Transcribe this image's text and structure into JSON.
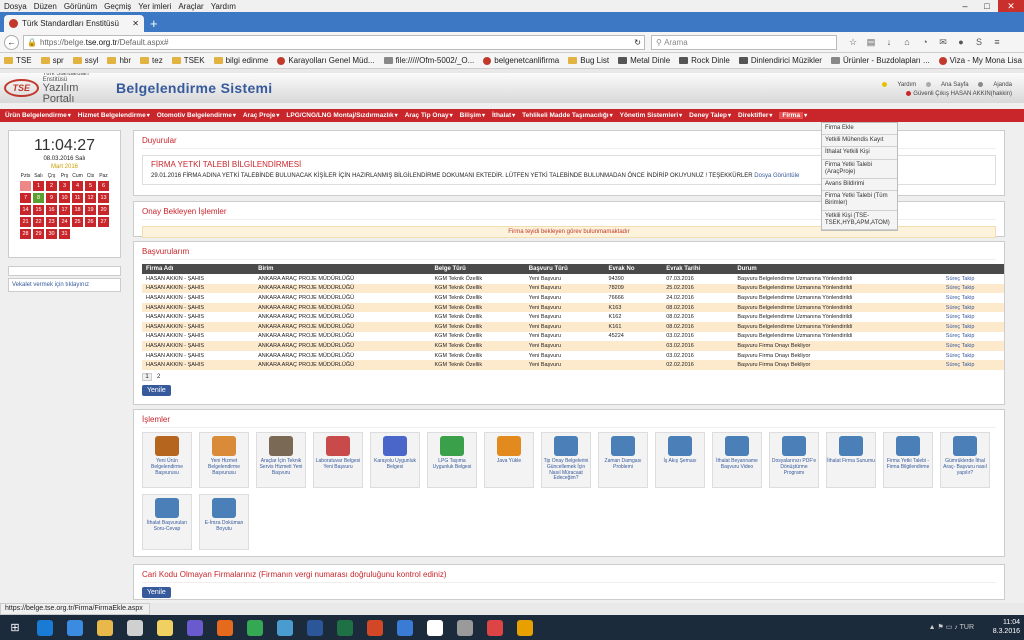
{
  "menubar": {
    "items": [
      "Dosya",
      "Düzen",
      "Görünüm",
      "Geçmiş",
      "Yer imleri",
      "Araçlar",
      "Yardım"
    ]
  },
  "tab": {
    "title": "Türk Standardları Enstitüsü"
  },
  "navbar": {
    "url_prefix": "https://belge.",
    "url_domain": "tse.org.tr",
    "url_suffix": "/Default.aspx#",
    "search_placeholder": "Arama"
  },
  "bookmarks": [
    {
      "label": "TSE",
      "icon": "folder"
    },
    {
      "label": "spr",
      "icon": "folder"
    },
    {
      "label": "ssyl",
      "icon": "folder"
    },
    {
      "label": "hbr",
      "icon": "folder"
    },
    {
      "label": "tez",
      "icon": "folder"
    },
    {
      "label": "TSEK",
      "icon": "folder"
    },
    {
      "label": "bilgi edinme",
      "icon": "folder"
    },
    {
      "label": "Karayolları Genel Müd...",
      "icon": "red"
    },
    {
      "label": "file://///Ofm-5002/_O...",
      "icon": "grey"
    },
    {
      "label": "belgenetcanlifirma",
      "icon": "red"
    },
    {
      "label": "Bug List",
      "icon": "folder"
    },
    {
      "label": "Metal Dinle",
      "icon": "guitar"
    },
    {
      "label": "Rock Dinle",
      "icon": "guitar"
    },
    {
      "label": "Dinlendirici Müzikler",
      "icon": "guitar"
    },
    {
      "label": "Ürünler - Buzdolapları ...",
      "icon": "grey"
    },
    {
      "label": "Viza - My Mona Lisa -...",
      "icon": "red"
    },
    {
      "label": "Ürünler - Buzdolapları ...",
      "icon": "grey"
    }
  ],
  "header": {
    "logo_small": "Türk Standardları Enstitüsü",
    "logo_big": "Yazılım Portalı",
    "logo_mark": "TSE",
    "system_title": "Belgelendirme Sistemi",
    "links": [
      "Yardım",
      "Ana Sayfa",
      "Ajanda"
    ],
    "user": "Güvenli Çıkış HASAN AKKIN(hakkin)"
  },
  "mainnav": [
    "Ürün Belgelendirme",
    "Hizmet Belgelendirme",
    "Otomotiv Belgelendirme",
    "Araç Proje",
    "LPG/CNG/LNG Montaj/Sızdırmazlık",
    "Araç Tip Onay",
    "Bilişim",
    "İthalat",
    "Tehlikeli Madde Taşımacılığı",
    "Yönetim Sistemleri",
    "Deney Talep",
    "Direktifler",
    "Firma"
  ],
  "dropdown": [
    "Firma Ekle",
    "Yetkili Mühendis Kayıt",
    "İthalat Yetkili Kişi",
    "Firma Yetki Talebi (AraçProje)",
    "Avans Bildirimi",
    "Firma Yetki Talebi (Tüm Birimler)",
    "Yetkili Kişi (TSE-TSEK,HYB,APM,ATOM)"
  ],
  "clock": {
    "time": "11:04:27",
    "date": "08.03.2016 Salı",
    "month": "Mart 2016",
    "weekdays": [
      "Pzts",
      "Salı",
      "Çrş",
      "Prş",
      "Cum",
      "Cts",
      "Paz"
    ],
    "weeks": [
      [
        "",
        "1",
        "2",
        "3",
        "4",
        "5",
        "6"
      ],
      [
        "7",
        "8",
        "9",
        "10",
        "11",
        "12",
        "13"
      ],
      [
        "14",
        "15",
        "16",
        "17",
        "18",
        "19",
        "20"
      ],
      [
        "21",
        "22",
        "23",
        "24",
        "25",
        "26",
        "27"
      ],
      [
        "28",
        "29",
        "30",
        "31",
        "",
        "",
        ""
      ]
    ]
  },
  "left": {
    "vekalet": "Vekalet vermek için tıklayınız"
  },
  "duyurular": {
    "title": "Duyurular",
    "ann_title": "FİRMA YETKİ TALEBİ BİLGİLENDİRMESİ",
    "ann_text": "29.01.2016 FİRMA ADINA YETKİ TALEBİNDE BULUNACAK KİŞİLER İÇİN HAZIRLANMIŞ BİLGİLENDİRME DOKUMANI EKTEDİR. LÜTFEN YETKİ TALEBİNDE BULUNMADAN ÖNCE İNDİRİP OKUYUNUZ ! TEŞEKKÜRLER",
    "ann_link": "Dosya Görüntüle"
  },
  "onay": {
    "title": "Onay Bekleyen İşlemler",
    "message": "Firma teyidi bekleyen görev bulunmamaktadır"
  },
  "basvurular": {
    "title": "Başvurularım",
    "columns": [
      "Firma Adı",
      "Birim",
      "Belge Türü",
      "Başvuru Türü",
      "Evrak No",
      "Evrak Tarihi",
      "Durum",
      ""
    ],
    "rows": [
      [
        "HASAN AKKIN - ŞAHIS",
        "ANKARA ARAÇ PROJE MÜDÜRLÜĞÜ",
        "KGM Teknik Özellik",
        "Yeni Başvuru",
        "94390",
        "07.03.2016",
        "Başvuru Belgelendirme Uzmanına Yönlendirildi",
        "Süreç Takip"
      ],
      [
        "HASAN AKKIN - ŞAHIS",
        "ANKARA ARAÇ PROJE MÜDÜRLÜĞÜ",
        "KGM Teknik Özellik",
        "Yeni Başvuru",
        "78209",
        "25.02.2016",
        "Başvuru Belgelendirme Uzmanına Yönlendirildi",
        "Süreç Takip"
      ],
      [
        "HASAN AKKIN - ŞAHIS",
        "ANKARA ARAÇ PROJE MÜDÜRLÜĞÜ",
        "KGM Teknik Özellik",
        "Yeni Başvuru",
        "76666",
        "24.02.2016",
        "Başvuru Belgelendirme Uzmanına Yönlendirildi",
        "Süreç Takip"
      ],
      [
        "HASAN AKKIN - ŞAHIS",
        "ANKARA ARAÇ PROJE MÜDÜRLÜĞÜ",
        "KGM Teknik Özellik",
        "Yeni Başvuru",
        "K163",
        "08.02.2016",
        "Başvuru Belgelendirme Uzmanına Yönlendirildi",
        "Süreç Takip"
      ],
      [
        "HASAN AKKIN - ŞAHIS",
        "ANKARA ARAÇ PROJE MÜDÜRLÜĞÜ",
        "KGM Teknik Özellik",
        "Yeni Başvuru",
        "K162",
        "08.02.2016",
        "Başvuru Belgelendirme Uzmanına Yönlendirildi",
        "Süreç Takip"
      ],
      [
        "HASAN AKKIN - ŞAHIS",
        "ANKARA ARAÇ PROJE MÜDÜRLÜĞÜ",
        "KGM Teknik Özellik",
        "Yeni Başvuru",
        "K161",
        "08.02.2016",
        "Başvuru Belgelendirme Uzmanına Yönlendirildi",
        "Süreç Takip"
      ],
      [
        "HASAN AKKIN - ŞAHIS",
        "ANKARA ARAÇ PROJE MÜDÜRLÜĞÜ",
        "KGM Teknik Özellik",
        "Yeni Başvuru",
        "45224",
        "03.02.2016",
        "Başvuru Belgelendirme Uzmanına Yönlendirildi",
        "Süreç Takip"
      ],
      [
        "HASAN AKKIN - ŞAHIS",
        "ANKARA ARAÇ PROJE MÜDÜRLÜĞÜ",
        "KGM Teknik Özellik",
        "Yeni Başvuru",
        "",
        "03.02.2016",
        "Başvuru Firma Onayı Bekliyor",
        "Süreç Takip"
      ],
      [
        "HASAN AKKIN - ŞAHIS",
        "ANKARA ARAÇ PROJE MÜDÜRLÜĞÜ",
        "KGM Teknik Özellik",
        "Yeni Başvuru",
        "",
        "03.02.2016",
        "Başvuru Firma Onayı Bekliyor",
        "Süreç Takip"
      ],
      [
        "HASAN AKKIN - ŞAHIS",
        "ANKARA ARAÇ PROJE MÜDÜRLÜĞÜ",
        "KGM Teknik Özellik",
        "Yeni Başvuru",
        "",
        "02.02.2016",
        "Başvuru Firma Onayı Bekliyor",
        "Süreç Takip"
      ]
    ],
    "pages": [
      "1",
      "2"
    ],
    "refresh": "Yenile"
  },
  "islemler": {
    "title": "İşlemler",
    "tiles": [
      {
        "label": "Yeni Ürün Belgelendirme Başvurusu",
        "color": "#b5651d"
      },
      {
        "label": "Yeni Hizmet Belgelendirme Başvurusu",
        "color": "#d98b3a"
      },
      {
        "label": "Araçlar İçin Teknik Servis Hizmeti Yeni Başvuru",
        "color": "#7a6a55"
      },
      {
        "label": "Laboratuvar Belgesi Yeni Başvuru",
        "color": "#c94a4a"
      },
      {
        "label": "Karayolu Uygunluk Belgesi",
        "color": "#4a66c9"
      },
      {
        "label": "LPG Taşıma Uygunluk Belgesi",
        "color": "#3aa14a"
      },
      {
        "label": "Java Yükle",
        "color": "#e38a1e"
      },
      {
        "label": "Tip Onay Belgelerini Güncellemek İçin Nasıl Müracaat Edeceğim?",
        "color": "#4a7fb8"
      },
      {
        "label": "Zaman Damgası Problemi",
        "color": "#4a7fb8"
      },
      {
        "label": "İş Akış Şeması",
        "color": "#4a7fb8"
      },
      {
        "label": "İthalat Beyanname Başvuru Video",
        "color": "#4a7fb8"
      },
      {
        "label": "Dosyalarınızı PDF'e Dönüştürme Programı",
        "color": "#4a7fb8"
      },
      {
        "label": "İthalat Firma Sunumu",
        "color": "#4a7fb8"
      },
      {
        "label": "Firma Yetki Talebi -Firma Bilgilendirme",
        "color": "#4a7fb8"
      },
      {
        "label": "Gümrüklerde İthal Araç- Başvuru nasıl yapılır?",
        "color": "#4a7fb8"
      },
      {
        "label": "İthalat Başvuruları Soru-Cevap",
        "color": "#4a7fb8"
      },
      {
        "label": "E-İmza Doküman Boyutu",
        "color": "#4a7fb8"
      }
    ]
  },
  "cari": {
    "title": "Cari Kodu Olmayan Firmalarınız (Firmanın vergi numarası doğruluğunu kontrol ediniz)",
    "refresh": "Yenile"
  },
  "status": {
    "text": "https://belge.tse.org.tr/Firma/FirmaEkle.aspx"
  },
  "taskbar": {
    "time": "11:04",
    "date": "8.3.2016",
    "apps": [
      "#1a7bd4",
      "#3b8be0",
      "#e8b84a",
      "#d0d0d0",
      "#f0d060",
      "#6a5acd",
      "#e66a1e",
      "#34a853",
      "#4a9bd0",
      "#2b579a",
      "#1e7145",
      "#d24726",
      "#3a7bd5",
      "#ffffff",
      "#9a9a9a",
      "#d44",
      "#e8a000"
    ]
  }
}
